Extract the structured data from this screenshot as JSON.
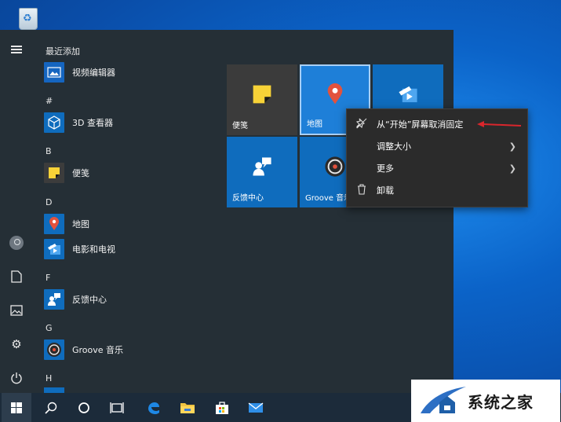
{
  "desktop": {
    "recycle_bin_icon": "recycle-bin-icon"
  },
  "start_menu": {
    "applist": [
      {
        "type": "header",
        "text": "最近添加"
      },
      {
        "type": "app",
        "label": "视频编辑器",
        "icon": "video-editor-icon",
        "color": "#1565c0"
      },
      {
        "type": "header",
        "text": "#"
      },
      {
        "type": "app",
        "label": "3D 查看器",
        "icon": "cube-3d-icon",
        "color": "#0f6cbd"
      },
      {
        "type": "header",
        "text": "B"
      },
      {
        "type": "app",
        "label": "便笺",
        "icon": "sticky-note-icon",
        "color": "#3c3c3c"
      },
      {
        "type": "header",
        "text": "D"
      },
      {
        "type": "app",
        "label": "地图",
        "icon": "map-pin-icon",
        "color": "#0f6cbd"
      },
      {
        "type": "app",
        "label": "电影和电视",
        "icon": "movies-tv-icon",
        "color": "#0f6cbd"
      },
      {
        "type": "header",
        "text": "F"
      },
      {
        "type": "app",
        "label": "反馈中心",
        "icon": "feedback-hub-icon",
        "color": "#0f6cbd"
      },
      {
        "type": "header",
        "text": "G"
      },
      {
        "type": "app",
        "label": "Groove 音乐",
        "icon": "groove-music-icon",
        "color": "#0f6cbd"
      },
      {
        "type": "header",
        "text": "H"
      }
    ],
    "tiles": [
      {
        "label": "便笺",
        "icon": "sticky-note-icon",
        "color": "#3b3b3b"
      },
      {
        "label": "地图",
        "icon": "map-pin-icon",
        "color": "#1e7fd8"
      },
      {
        "label": "",
        "icon": "movies-tv-icon",
        "color": "#0f6cbd"
      },
      {
        "label": "反馈中心",
        "icon": "feedback-hub-icon",
        "color": "#0f6cbd"
      },
      {
        "label": "Groove 音乐",
        "icon": "groove-music-icon",
        "color": "#0f6cbd"
      }
    ]
  },
  "context_menu": {
    "items": [
      {
        "label": "从“开始”屏幕取消固定",
        "icon": "unpin-icon",
        "submenu": false
      },
      {
        "label": "调整大小",
        "icon": "",
        "submenu": true
      },
      {
        "label": "更多",
        "icon": "",
        "submenu": true
      },
      {
        "label": "卸载",
        "icon": "trash-icon",
        "submenu": false
      }
    ]
  },
  "annotation": {
    "arrow_color": "#d9262c"
  },
  "taskbar": {
    "items": [
      "start-icon",
      "search-icon",
      "cortana-icon",
      "task-view-icon",
      "edge-icon",
      "file-explorer-icon",
      "store-icon",
      "mail-icon"
    ]
  },
  "watermark": {
    "text": "系统之家"
  }
}
